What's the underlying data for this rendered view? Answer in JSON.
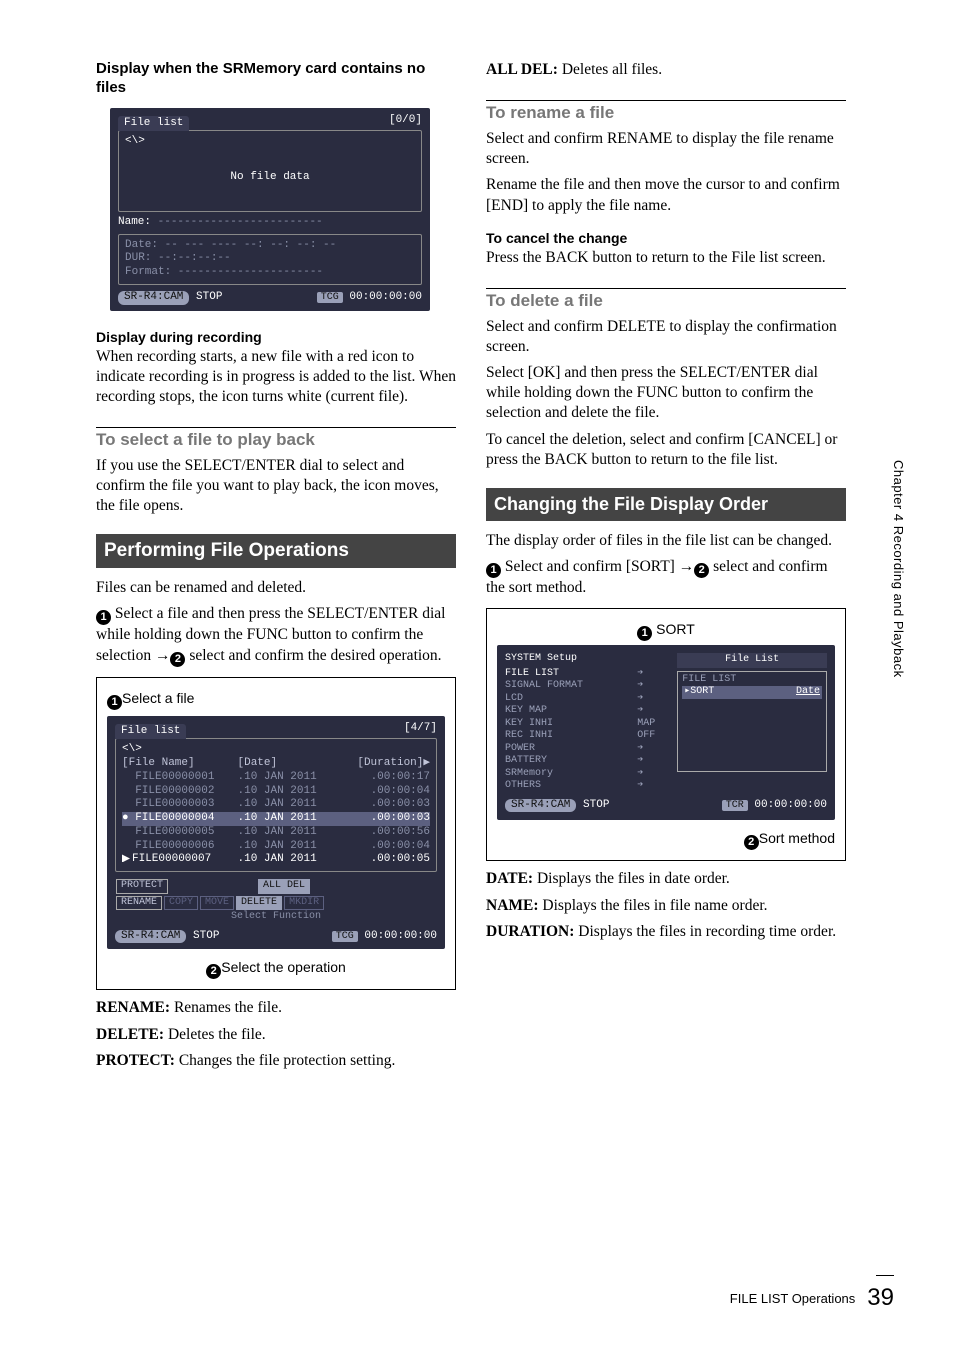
{
  "left": {
    "h1": "Display when the SRMemory card contains no files",
    "screen_nofile": {
      "title": "File list",
      "counter": "[0/0]",
      "path": "<\\>",
      "msg": "No file data",
      "name_label": "Name:",
      "name_dashes": "-------------------------",
      "date": "Date: -- --- ---- --: --: --: --",
      "dur": "DUR:  --:--:--:--",
      "fmt": "Format: ----------------------",
      "cam": "SR-R4:CAM",
      "stop": "STOP",
      "tcg_lbl": "TCG",
      "tcg": "00:00:00:00"
    },
    "h2": "Display during recording",
    "p1": "When recording starts, a new file with a red icon to indicate recording is in progress is added to the list. When recording stops, the icon turns white (current file).",
    "sec1": "To select a file to play back",
    "p2": "If you use the SELECT/ENTER dial to select and confirm the file you want to play back, the icon moves, the file opens.",
    "block": "Performing File Operations",
    "p3": "Files can be renamed and deleted.",
    "p4a": " Select a file and then press the SELECT/ENTER dial while holding down the FUNC button to confirm the selection →",
    "p4b": " select and confirm the desired operation.",
    "illus1_label": "Select a file",
    "screen_list": {
      "title": "File list",
      "counter": "[4/7]",
      "path": "<\\>",
      "col_name": "[File Name]",
      "col_date": "[Date]",
      "col_dur": "[Duration]▶",
      "rows": [
        {
          "name": "FILE00000001",
          "date": ".10 JAN 2011",
          "dur": ".00:00:17",
          "style": "dim"
        },
        {
          "name": "FILE00000002",
          "date": ".10 JAN 2011",
          "dur": ".00:00:04",
          "style": "dim"
        },
        {
          "name": "FILE00000003",
          "date": ".10 JAN 2011",
          "dur": ".00:00:03",
          "style": "dim"
        },
        {
          "name": "FILE00000004",
          "date": ".10 JAN 2011",
          "dur": ".00:00:03",
          "style": "hl"
        },
        {
          "name": "FILE00000005",
          "date": ".10 JAN 2011",
          "dur": ".00:00:56",
          "style": "dim"
        },
        {
          "name": "FILE00000006",
          "date": ".10 JAN 2011",
          "dur": ".00:00:04",
          "style": "dim"
        },
        {
          "name": "FILE00000007",
          "date": ".10 JAN 2011",
          "dur": ".00:00:05",
          "style": "play"
        }
      ],
      "buttons_row1": [
        "PROTECT",
        "",
        "",
        "ALL DEL",
        ""
      ],
      "buttons_row2": [
        "RENAME",
        "COPY",
        "MOVE",
        "DELETE",
        "MKDIR"
      ],
      "selectfn": "Select Function",
      "cam": "SR-R4:CAM",
      "stop": "STOP",
      "tcg_lbl": "TCG",
      "tcg": "00:00:00:00"
    },
    "illus1_caption": "Select the operation",
    "def_rename_t": "RENAME:",
    "def_rename_d": " Renames the file.",
    "def_delete_t": "DELETE:",
    "def_delete_d": " Deletes the file.",
    "def_protect_t": "PROTECT:",
    "def_protect_d": " Changes the file protection setting."
  },
  "right": {
    "def_alldel_t": "ALL DEL:",
    "def_alldel_d": " Deletes all files.",
    "sec_rename": "To rename a file",
    "p_rename1": "Select and confirm RENAME to display the file rename screen.",
    "p_rename2": "Rename the file and then move the cursor to and confirm [END] to apply the file name.",
    "h_cancel": "To cancel the change",
    "p_cancel": "Press the BACK button to return to the File list screen.",
    "sec_delete": "To delete a file",
    "p_del1": "Select and confirm DELETE to display the confirmation screen.",
    "p_del2": "Select [OK] and then press the SELECT/ENTER dial while holding down the FUNC button to confirm the selection and delete the file.",
    "p_del3": "To cancel the deletion, select and confirm [CANCEL] or press the BACK button to return to the file list.",
    "block": "Changing the File Display Order",
    "p_order": "The display order of files in the file list can be changed.",
    "step_a": " Select and confirm [SORT] →",
    "step_b": " select and confirm the sort method.",
    "sort_label": "SORT",
    "syssetup": {
      "title": "SYSTEM Setup",
      "items": [
        {
          "l": "FILE LIST",
          "v": "➔",
          "hl": true
        },
        {
          "l": "SIGNAL FORMAT",
          "v": "➔"
        },
        {
          "l": "LCD",
          "v": "➔"
        },
        {
          "l": "KEY MAP",
          "v": "➔"
        },
        {
          "l": "KEY INHI",
          "v": "MAP"
        },
        {
          "l": "REC INHI",
          "v": "OFF"
        },
        {
          "l": "POWER",
          "v": "➔"
        },
        {
          "l": "BATTERY",
          "v": "➔"
        },
        {
          "l": "SRMemory",
          "v": "➔"
        },
        {
          "l": "OTHERS",
          "v": "➔"
        }
      ],
      "right_title": "File List",
      "right_sub": "FILE LIST",
      "sort_item": "SORT",
      "sort_val": "Date",
      "cam": "SR-R4:CAM",
      "stop": "STOP",
      "tcr_lbl": "TCR",
      "tcr": "00:00:00:00"
    },
    "illus2_caption": "Sort method",
    "def_date_t": "DATE:",
    "def_date_d": " Displays the files in date order.",
    "def_name_t": "NAME:",
    "def_name_d": " Displays the files in file name order.",
    "def_dur_t": "DURATION:",
    "def_dur_d": " Displays the files in recording time order."
  },
  "side": "Chapter 4  Recording and Playback",
  "footer_text": "FILE LIST Operations",
  "page_num": "39"
}
